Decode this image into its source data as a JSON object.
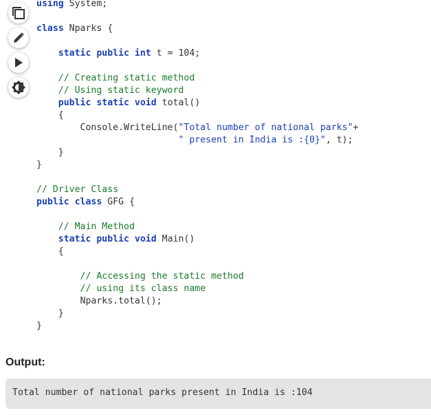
{
  "toolbar": {
    "copy_icon": "copy-icon",
    "edit_icon": "pencil-icon",
    "run_icon": "play-icon",
    "theme_icon": "brightness-icon"
  },
  "code": {
    "lines": [
      [
        [
          "kw",
          "using"
        ],
        [
          "tx",
          " System;"
        ]
      ],
      [],
      [
        [
          "kw",
          "class"
        ],
        [
          "tx",
          " Nparks {"
        ]
      ],
      [],
      [
        [
          "tx",
          "    "
        ],
        [
          "kw",
          "static public int"
        ],
        [
          "tx",
          " t = 104;"
        ]
      ],
      [],
      [
        [
          "tx",
          "    "
        ],
        [
          "cm",
          "// Creating static method"
        ]
      ],
      [
        [
          "tx",
          "    "
        ],
        [
          "cm",
          "// Using static keyword"
        ]
      ],
      [
        [
          "tx",
          "    "
        ],
        [
          "kw",
          "public static void"
        ],
        [
          "tx",
          " total()"
        ]
      ],
      [
        [
          "tx",
          "    {"
        ]
      ],
      [
        [
          "tx",
          "        Console.WriteLine("
        ],
        [
          "st",
          "\"Total number of national parks\""
        ],
        [
          "tx",
          "+"
        ]
      ],
      [
        [
          "tx",
          "                          "
        ],
        [
          "st",
          "\" present in India is :{0}\""
        ],
        [
          "tx",
          ", t);"
        ]
      ],
      [
        [
          "tx",
          "    }"
        ]
      ],
      [
        [
          "tx",
          "}"
        ]
      ],
      [],
      [
        [
          "cm",
          "// Driver Class"
        ]
      ],
      [
        [
          "kw",
          "public class"
        ],
        [
          "tx",
          " GFG {"
        ]
      ],
      [],
      [
        [
          "tx",
          "    "
        ],
        [
          "cm",
          "// Main Method"
        ]
      ],
      [
        [
          "tx",
          "    "
        ],
        [
          "kw",
          "static public void"
        ],
        [
          "tx",
          " Main()"
        ]
      ],
      [
        [
          "tx",
          "    {"
        ]
      ],
      [],
      [
        [
          "tx",
          "        "
        ],
        [
          "cm",
          "// Accessing the static method"
        ]
      ],
      [
        [
          "tx",
          "        "
        ],
        [
          "cm",
          "// using its class name"
        ]
      ],
      [
        [
          "tx",
          "        Nparks.total();"
        ]
      ],
      [
        [
          "tx",
          "    }"
        ]
      ],
      [
        [
          "tx",
          "}"
        ]
      ]
    ]
  },
  "output": {
    "label": "Output:",
    "text": "Total number of national parks present in India is :104"
  }
}
